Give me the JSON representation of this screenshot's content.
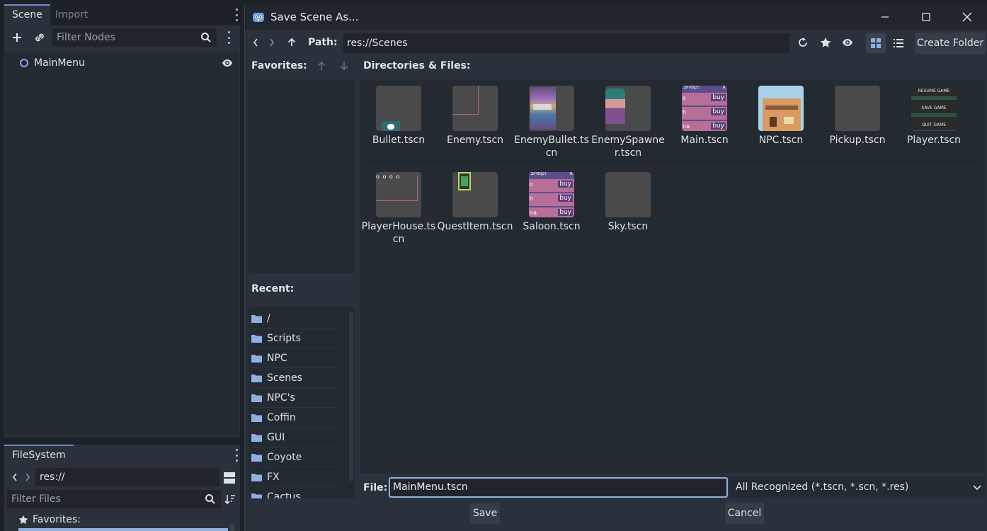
{
  "editor": {
    "scene_tab": "Scene",
    "import_tab": "Import",
    "filter_nodes_placeholder": "Filter Nodes",
    "tree_root": "MainMenu",
    "filesystem_tab": "FileSystem",
    "fs_path": "res://",
    "filter_files_placeholder": "Filter Files",
    "favorites_label": "Favorites:"
  },
  "dialog": {
    "title": "Save Scene As...",
    "path_label": "Path:",
    "path_value": "res://Scenes",
    "create_folder_label": "Create Folder",
    "favorites_label": "Favorites:",
    "dirs_files_label": "Directories & Files:",
    "recent_label": "Recent:",
    "recent_items": [
      "/",
      "Scripts",
      "NPC",
      "Scenes",
      "NPC's",
      "Coffin",
      "GUI",
      "Coyote",
      "FX",
      "Cactus"
    ],
    "files": [
      {
        "name": "Bullet.tscn",
        "thumb": "bullet"
      },
      {
        "name": "Enemy.tscn",
        "thumb": "enemy"
      },
      {
        "name": "EnemyBullet.tscn",
        "thumb": "sprite-robot"
      },
      {
        "name": "EnemySpawner.tscn",
        "thumb": "sprite-cowboy"
      },
      {
        "name": "Main.tscn",
        "thumb": "shop"
      },
      {
        "name": "NPC.tscn",
        "thumb": "building"
      },
      {
        "name": "Pickup.tscn",
        "thumb": "blank"
      },
      {
        "name": "Player.tscn",
        "thumb": "menu"
      },
      {
        "name": "PlayerHouse.tscn",
        "thumb": "house"
      },
      {
        "name": "QuestItem.tscn",
        "thumb": "book"
      },
      {
        "name": "Saloon.tscn",
        "thumb": "shop"
      },
      {
        "name": "Sky.tscn",
        "thumb": "blank"
      }
    ],
    "shop_labels": {
      "buy": "buy",
      "top": "Shop!",
      "close": "x",
      "rows": [
        "o",
        "h",
        "na"
      ]
    },
    "menu_labels": [
      "RESUME GAME",
      "SAVE GAME",
      "QUIT GAME"
    ],
    "file_label": "File:",
    "file_value": "MainMenu.tscn",
    "filter_value": "All Recognized (*.tscn, *.scn, *.res)",
    "save_label": "Save",
    "cancel_label": "Cancel"
  },
  "colors": {
    "accent": "#6f8ec6",
    "focus": "#8fb1e0",
    "folder": "#8fb1e0"
  }
}
